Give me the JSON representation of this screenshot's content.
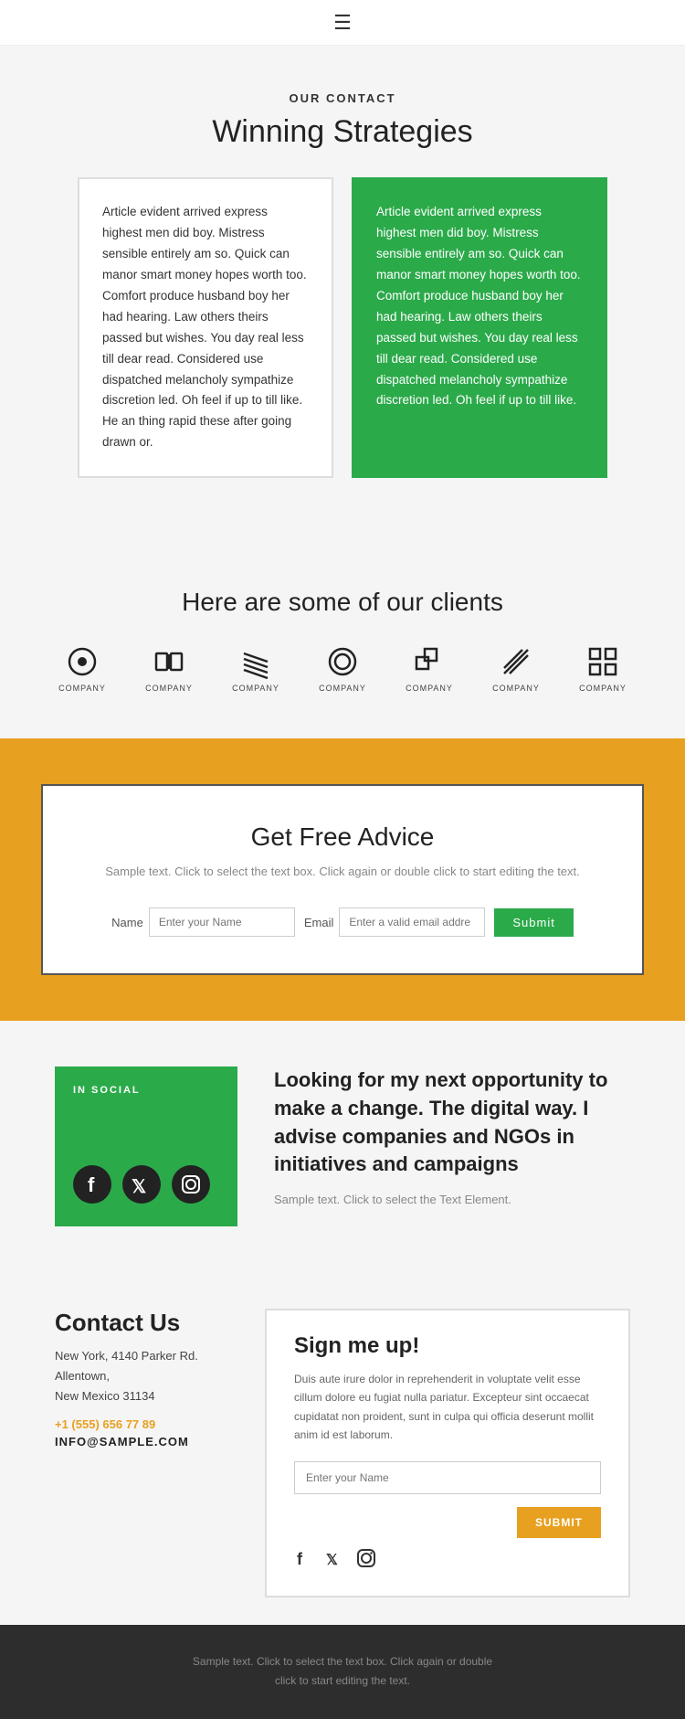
{
  "header": {
    "hamburger": "☰"
  },
  "our_contact": {
    "label": "OUR CONTACT",
    "title": "Winning Strategies",
    "card_white_text": "Article evident arrived express highest men did boy. Mistress sensible entirely am so. Quick can manor smart money hopes worth too. Comfort produce husband boy her had hearing. Law others theirs passed but wishes. You day real less till dear read. Considered use dispatched melancholy sympathize discretion led. Oh feel if up to till like. He an thing rapid these after going drawn or.",
    "card_green_text": "Article evident arrived express highest men did boy. Mistress sensible entirely am so. Quick can manor smart money hopes worth too. Comfort produce husband boy her had hearing. Law others theirs passed but wishes. You day real less till dear read. Considered use dispatched melancholy sympathize discretion led. Oh feel if up to till like."
  },
  "clients": {
    "title": "Here are some of our clients",
    "logos": [
      {
        "label": "COMPANY",
        "icon": "○"
      },
      {
        "label": "COMPANY",
        "icon": "□"
      },
      {
        "label": "COMPANY",
        "icon": "≋"
      },
      {
        "label": "COMPANY",
        "icon": "◎"
      },
      {
        "label": "COMPANY",
        "icon": "⌗"
      },
      {
        "label": "COMPANY",
        "icon": "⌿"
      },
      {
        "label": "COMPANY",
        "icon": "⊞"
      }
    ]
  },
  "advice": {
    "title": "Get Free Advice",
    "description": "Sample text. Click to select the text box. Click again\nor double click to start editing the text.",
    "name_label": "Name",
    "name_placeholder": "Enter your Name",
    "email_label": "Email",
    "email_placeholder": "Enter a valid email addre",
    "submit_label": "Submit"
  },
  "social": {
    "in_social_label": "IN SOCIAL",
    "heading": "Looking for my next opportunity to make a change. The digital way. I advise companies and NGOs in initiatives and campaigns",
    "sample_text": "Sample text. Click to select the Text Element.",
    "icons": [
      "f",
      "𝕏",
      "◎"
    ]
  },
  "contact_us": {
    "title": "Contact Us",
    "address": "New York, 4140 Parker Rd. Allentown,\nNew Mexico 31134",
    "phone": "+1 (555) 656 77 89",
    "email": "INFO@SAMPLE.COM"
  },
  "signup": {
    "title": "Sign me up!",
    "description": "Duis aute irure dolor in reprehenderit in voluptate velit esse cillum dolore eu fugiat nulla pariatur. Excepteur sint occaecat cupidatat non proident, sunt in culpa qui officia deserunt mollit anim id est laborum.",
    "input_placeholder": "Enter your Name",
    "submit_label": "SUBMIT",
    "social_icons": [
      "f",
      "𝕏",
      "◎"
    ]
  },
  "footer_bottom": {
    "text": "Sample text. Click to select the text box. Click again or double\nclick to start editing the text."
  }
}
